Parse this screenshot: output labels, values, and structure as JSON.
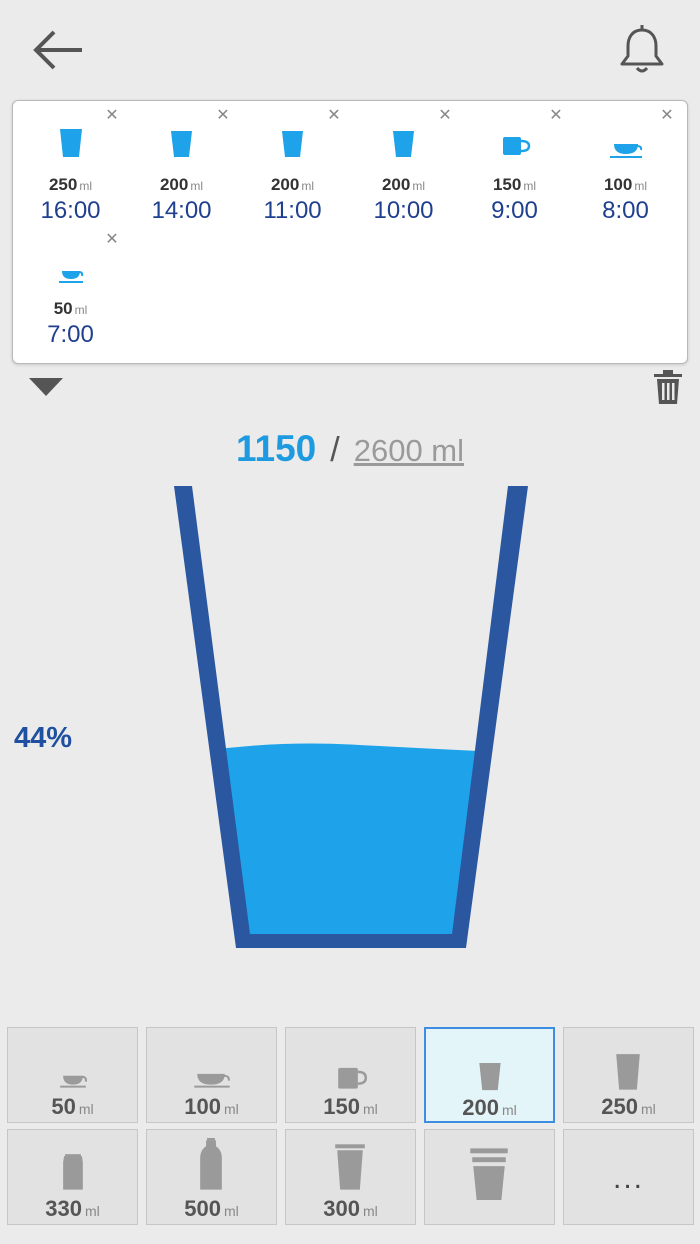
{
  "colors": {
    "accent": "#1e9be0",
    "glass": "#2a57a0",
    "water": "#1ea3ea",
    "time_text": "#1f3f8f",
    "background": "#ebebeb"
  },
  "header": {
    "back_icon": "arrow-left-icon",
    "reminder_icon": "bell-icon"
  },
  "log": {
    "unit": "ml",
    "entries": [
      {
        "amount": "250",
        "time": "16:00",
        "icon": "glass-icon"
      },
      {
        "amount": "200",
        "time": "14:00",
        "icon": "glass-icon"
      },
      {
        "amount": "200",
        "time": "11:00",
        "icon": "glass-icon"
      },
      {
        "amount": "200",
        "time": "10:00",
        "icon": "glass-icon"
      },
      {
        "amount": "150",
        "time": "9:00",
        "icon": "mug-icon"
      },
      {
        "amount": "100",
        "time": "8:00",
        "icon": "teacup-icon"
      },
      {
        "amount": "50",
        "time": "7:00",
        "icon": "small-cup-icon"
      }
    ],
    "remove_glyph": "✕"
  },
  "progress": {
    "current": "1150",
    "separator": "/",
    "goal": "2600 ml",
    "percent_label": "44%",
    "fill_fraction": 0.44
  },
  "drinks": {
    "unit": "ml",
    "buttons": [
      {
        "amount": "50",
        "icon": "small-cup-icon",
        "selected": false
      },
      {
        "amount": "100",
        "icon": "teacup-icon",
        "selected": false
      },
      {
        "amount": "150",
        "icon": "mug-icon",
        "selected": false
      },
      {
        "amount": "200",
        "icon": "glass-icon",
        "selected": true
      },
      {
        "amount": "250",
        "icon": "tall-glass-icon",
        "selected": false
      },
      {
        "amount": "330",
        "icon": "can-icon",
        "selected": false
      },
      {
        "amount": "500",
        "icon": "bottle-icon",
        "selected": false
      },
      {
        "amount": "300",
        "icon": "large-glass-icon",
        "selected": false
      },
      {
        "amount": "",
        "icon": "custom-cup-icon",
        "selected": false
      },
      {
        "amount": "",
        "more": "...",
        "icon": "more-icon",
        "selected": false
      }
    ]
  }
}
